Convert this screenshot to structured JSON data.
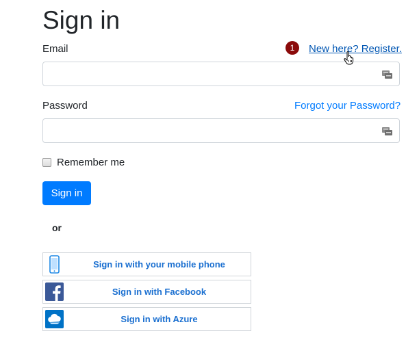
{
  "title": "Sign in",
  "email": {
    "label": "Email",
    "value": "",
    "placeholder": ""
  },
  "password": {
    "label": "Password",
    "value": "",
    "placeholder": ""
  },
  "register": {
    "badge": "1",
    "link": "New here? Register."
  },
  "forgot_link": "Forgot your Password?",
  "remember_label": "Remember me",
  "signin_button": "Sign in",
  "or_text": "or",
  "social": [
    {
      "label": "Sign in with your mobile phone",
      "icon": "mobile-phone-icon"
    },
    {
      "label": "Sign in with Facebook",
      "icon": "facebook-icon"
    },
    {
      "label": "Sign in with Azure",
      "icon": "azure-cloud-icon"
    }
  ],
  "colors": {
    "primary": "#007bff",
    "badge": "#8b0a0a",
    "social_text": "#1a6fd0",
    "facebook": "#3b5998",
    "azure": "#0072c6"
  }
}
